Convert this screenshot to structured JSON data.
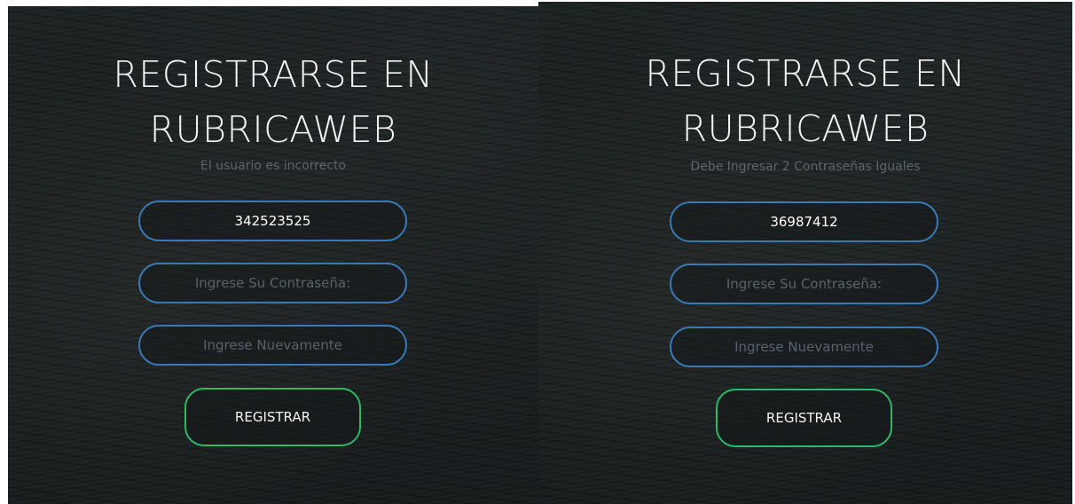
{
  "panels": [
    {
      "title_line1": "REGISTRARSE EN",
      "title_line2": "RUBRICAWEB",
      "message": "El usuario es incorrecto",
      "username_value": "342523525",
      "password_placeholder": "Ingrese Su Contraseña:",
      "confirm_placeholder": "Ingrese Nuevamente",
      "register_label": "REGISTRAR"
    },
    {
      "title_line1": "REGISTRARSE EN",
      "title_line2": "RUBRICAWEB",
      "message": "Debe Ingresar 2 Contraseñas Iguales",
      "username_value": "36987412",
      "password_placeholder": "Ingrese Su Contraseña:",
      "confirm_placeholder": "Ingrese Nuevamente",
      "register_label": "REGISTRAR"
    }
  ],
  "colors": {
    "background": "#1b2021",
    "input_border": "#3a78b6",
    "button_border": "#2fb865",
    "title_text": "#f2f4f4",
    "message_text": "#5d6566"
  }
}
